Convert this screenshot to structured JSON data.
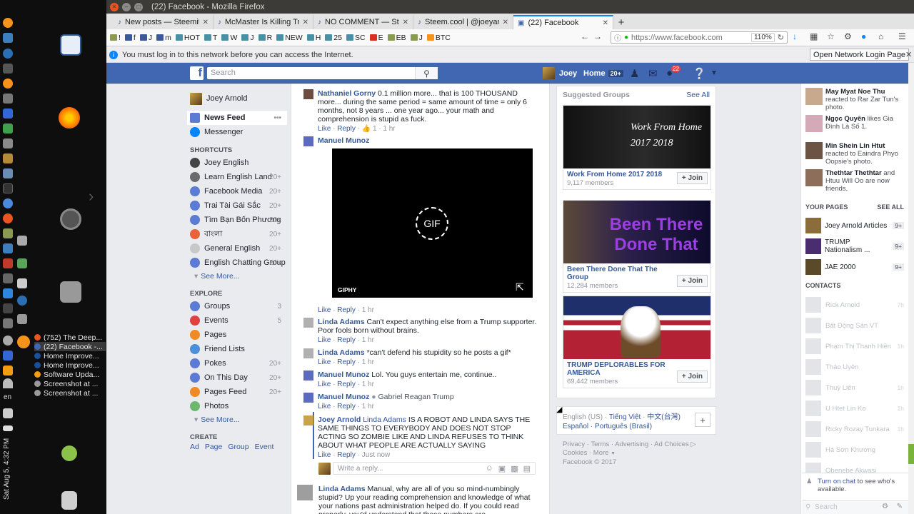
{
  "window": {
    "title": "(22) Facebook - Mozilla Firefox"
  },
  "tabs": [
    {
      "label": "New posts — Steemit",
      "active": false
    },
    {
      "label": "McMaster Is Killing Tru",
      "active": false
    },
    {
      "label": "NO COMMENT — Steem",
      "active": false
    },
    {
      "label": "Steem.cool | @joeyarnold",
      "active": false
    },
    {
      "label": "(22) Facebook",
      "active": true
    }
  ],
  "bookmarks": [
    "!",
    "f",
    "J",
    "m",
    "HOT",
    "T",
    "W",
    "J",
    "R",
    "NEW",
    "H",
    "25",
    "SC",
    "E",
    "EB",
    "J",
    "BTC"
  ],
  "urlbar": {
    "url": "https://www.facebook.com",
    "zoom": "110%"
  },
  "notice": {
    "text": "You must log in to this network before you can access the Internet.",
    "button": "Open Network Login Page"
  },
  "taskbar": [
    {
      "label": "(752) The Deep...",
      "active": false
    },
    {
      "label": "(22) Facebook -...",
      "active": true
    },
    {
      "label": "Home Improve...",
      "active": false
    },
    {
      "label": "Home Improve...",
      "active": false
    },
    {
      "label": "Software Upda...",
      "active": false
    },
    {
      "label": "Screenshot at ...",
      "active": false
    },
    {
      "label": "Screenshot at ...",
      "active": false
    }
  ],
  "system": {
    "lang": "en",
    "clock": "Sat Aug 5, 4:32 PM"
  },
  "fb_header": {
    "search_placeholder": "Search",
    "user": "Joey",
    "home": "Home",
    "home_count": "20+",
    "notif_count": "22"
  },
  "left_nav": {
    "user": "Joey Arnold",
    "main": [
      {
        "label": "News Feed",
        "more": "•••"
      },
      {
        "label": "Messenger"
      }
    ],
    "shortcuts_head": "SHORTCUTS",
    "shortcuts": [
      {
        "label": "Joey English",
        "count": ""
      },
      {
        "label": "Learn English Land",
        "count": "20+"
      },
      {
        "label": "Facebook Media",
        "count": "20+"
      },
      {
        "label": "Trai Tài Gái Sắc",
        "count": "20+"
      },
      {
        "label": "Tìm Bạn Bốn Phương",
        "count": "20+"
      },
      {
        "label": "বাংলা",
        "count": "20+"
      },
      {
        "label": "General English",
        "count": "20+"
      },
      {
        "label": "English Chatting Group",
        "count": "20+"
      }
    ],
    "see_more": "See More...",
    "explore_head": "EXPLORE",
    "explore": [
      {
        "label": "Groups",
        "count": "3"
      },
      {
        "label": "Events",
        "count": "5"
      },
      {
        "label": "Pages",
        "count": ""
      },
      {
        "label": "Friend Lists",
        "count": ""
      },
      {
        "label": "Pokes",
        "count": "20+"
      },
      {
        "label": "On This Day",
        "count": "20+"
      },
      {
        "label": "Pages Feed",
        "count": "20+"
      },
      {
        "label": "Photos",
        "count": ""
      }
    ],
    "see_more_2": "See More...",
    "create_head": "CREATE",
    "create": [
      "Ad",
      "Page",
      "Group",
      "Event"
    ]
  },
  "feed": {
    "comments": [
      {
        "name": "Nathaniel Gorny",
        "text": "0.1 million more... that is 100 THOUSAND more... during the same period = same amount of time = only 6 months, not 8 years ... one year ago... your math and comprehension is stupid as fuck.",
        "like": "Like",
        "reply": "Reply",
        "likes": "1",
        "time": "1 hr"
      },
      {
        "name": "Manuel Munoz",
        "text": "",
        "like": "Like",
        "reply": "Reply",
        "time": "1 hr"
      },
      {
        "name": "Linda Adams",
        "text": "Can't expect anything else from a Trump supporter. Poor fools born without brains.",
        "like": "Like",
        "reply": "Reply",
        "time": "1 hr"
      },
      {
        "name": "Linda Adams",
        "text": "*can't defend his stupidity so he posts a gif*",
        "like": "Like",
        "reply": "Reply",
        "time": "1 hr"
      },
      {
        "name": "Manuel Munoz",
        "text": "Lol. You guys entertain me, continue..",
        "like": "Like",
        "reply": "Reply",
        "time": "1 hr"
      },
      {
        "name": "Manuel Munoz",
        "text": "Gabriel Reagan Trump",
        "like": "Like",
        "reply": "Reply",
        "time": "1 hr"
      },
      {
        "name": "Joey Arnold",
        "mention": "Linda Adams",
        "text": "IS A ROBOT AND LINDA SAYS THE SAME THINGS TO EVERYBODY AND DOES NOT STOP ACTING SO ZOMBIE LIKE AND LINDA REFUSES TO THINK ABOUT WHAT PEOPLE ARE ACTUALLY SAYING",
        "like": "Like",
        "reply": "Reply",
        "time": "Just now"
      },
      {
        "name": "Linda Adams",
        "text": "Manual, why are all of you so mind-numbingly stupid? Up your reading comprehension and knowledge of what your nations past administration helped do. If you could read properly, you'd understand that these numbers are"
      }
    ],
    "gif": {
      "badge": "GIF",
      "label": "GIPHY"
    },
    "reply_placeholder": "Write a reply..."
  },
  "suggested": {
    "title": "Suggested Groups",
    "see_all": "See All",
    "join": "Join",
    "groups": [
      {
        "name": "Work From Home 2017 2018",
        "members": "9,117 members",
        "img_text": "Work From Home 2017 2018"
      },
      {
        "name": "Been There Done That The Group",
        "members": "12,284 members",
        "img_text": "Been There Done That"
      },
      {
        "name": "TRUMP DEPLORABLES FOR AMERICA",
        "members": "69,442 members",
        "img_text": ""
      }
    ]
  },
  "languages": {
    "current": "English (US)",
    "options": [
      "Tiếng Việt",
      "中文(台灣)",
      "Español",
      "Português (Brasil)"
    ]
  },
  "footer": {
    "links": [
      "Privacy",
      "Terms",
      "Advertising",
      "Ad Choices",
      "Cookies",
      "More"
    ],
    "copyright": "Facebook © 2017"
  },
  "ticker": {
    "items": [
      {
        "name": "May Myat Noe Thu",
        "text": "reacted to Rar Zar Tun's photo."
      },
      {
        "name": "Ngọc Quyên",
        "text": "likes Gia Đình Là Số 1."
      },
      {
        "name": "Min Shein Lin Htut",
        "text": "reacted to Eaindra Phyo Oopsie's photo."
      },
      {
        "name": "Thethtar Thethtar",
        "text": "and Htuu Will Oo are now friends."
      }
    ],
    "pages_head": "YOUR PAGES",
    "pages_see_all": "SEE ALL",
    "pages": [
      {
        "name": "Joey Arnold Articles",
        "count": "9+"
      },
      {
        "name": "TRUMP Nationalism ...",
        "count": "9+"
      },
      {
        "name": "JAE 2000",
        "count": "9+"
      }
    ],
    "contacts_head": "CONTACTS",
    "contacts": [
      {
        "name": "Rick Arnold",
        "time": "7h"
      },
      {
        "name": "Bất Động Sản VT",
        "time": ""
      },
      {
        "name": "Phạm Thị Thanh Hiền",
        "time": "1h"
      },
      {
        "name": "Thảo Uyên",
        "time": ""
      },
      {
        "name": "Thuỳ Liên",
        "time": "1h"
      },
      {
        "name": "U Htet Lin Ko",
        "time": "1h"
      },
      {
        "name": "Ricky Rozay Tunkara",
        "time": "1h"
      },
      {
        "name": "Hà Sơn Khương",
        "time": ""
      },
      {
        "name": "Obenebe Akwasi",
        "time": ""
      }
    ],
    "chat_link": "Turn on chat",
    "chat_text": "to see who's available.",
    "search_placeholder": "Search"
  }
}
